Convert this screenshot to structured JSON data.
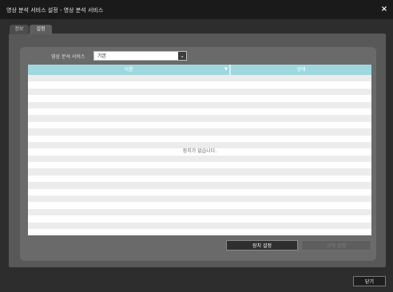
{
  "window": {
    "title": "영상 분석 서비스 설정 - 영상 분석 서비스",
    "close_symbol": "×"
  },
  "tabs": [
    {
      "label": "정보",
      "active": false
    },
    {
      "label": "설정",
      "active": true
    }
  ],
  "service": {
    "label": "영상 분석 서비스",
    "selected": "기본",
    "dropdown_icon": "chevron-down-icon"
  },
  "table": {
    "columns": [
      "이름",
      "상태"
    ],
    "sort_icon": "▼",
    "rows": [],
    "empty_message": "장치가 없습니다."
  },
  "buttons": {
    "device_settings": "장치 설정",
    "rule_settings": "규칙 설정",
    "rule_settings_enabled": false,
    "close": "닫기"
  },
  "colors": {
    "header": "#9ed8de",
    "background": "#2d2d2d",
    "panel": "#585858"
  }
}
